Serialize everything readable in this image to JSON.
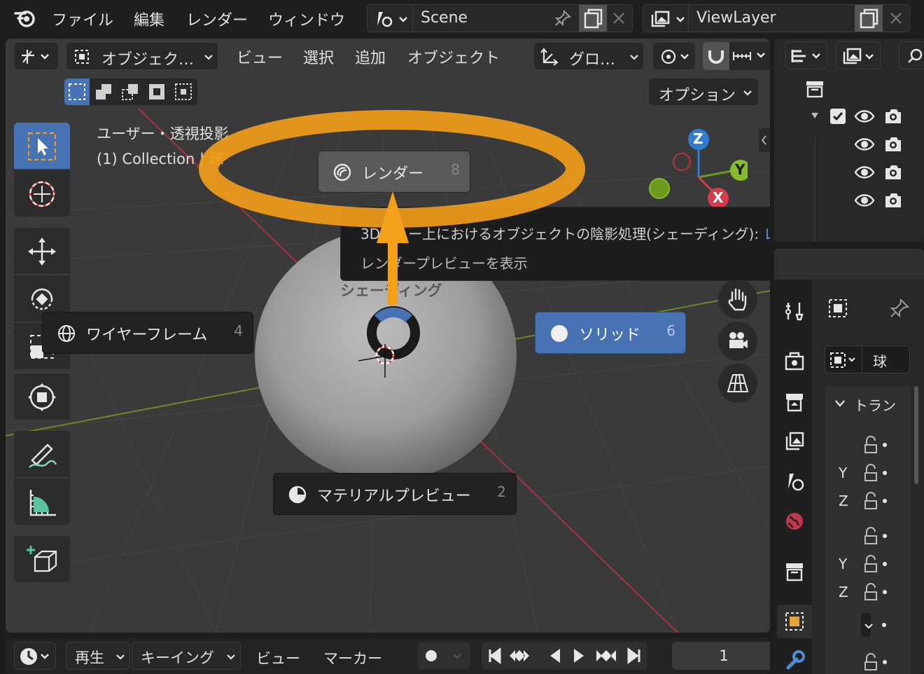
{
  "topbar": {
    "menus": [
      "ファイル",
      "編集",
      "レンダー",
      "ウィンドウ"
    ],
    "scene_name": "Scene",
    "view_layer_name": "ViewLayer"
  },
  "viewport_header": {
    "mode_label": "オブジェク…",
    "menus": [
      "ビュー",
      "選択",
      "追加",
      "オブジェクト"
    ],
    "transform_orientation": "グロ…",
    "options_label": "オプション"
  },
  "overlay_info": {
    "view_name": "ユーザー・透視投影",
    "collection_text": "(1) Collection | ",
    "object_name": "球"
  },
  "pie_menu": {
    "title": "シェーディング",
    "items": [
      {
        "label": "レンダー",
        "shortcut": "8"
      },
      {
        "label": "ワイヤーフレーム",
        "shortcut": "4"
      },
      {
        "label": "ソリッド",
        "shortcut": "6"
      },
      {
        "label": "マテリアルプレビュー",
        "shortcut": "2"
      }
    ]
  },
  "tooltip": {
    "line1_prefix": "3Dビュー上におけるオブジェクトの陰影処理(シェーディング): ",
    "line1_value": "レンダー",
    "line2": "レンダープレビューを表示"
  },
  "gizmo": {
    "z": "Z",
    "y": "Y",
    "x": "X"
  },
  "properties": {
    "object_name": "球",
    "section_label": "トラン",
    "axis_labels": [
      "Y",
      "Z",
      "Y",
      "Z"
    ]
  },
  "timeline": {
    "playback_label": "再生",
    "keying_label": "キーイング",
    "view_label": "ビュー",
    "marker_label": "マーカー",
    "current_frame": "1"
  },
  "colors": {
    "highlight_ring": "#f5a01a",
    "accent_blue": "#4772b3",
    "object_orange": "#e8a23c"
  }
}
